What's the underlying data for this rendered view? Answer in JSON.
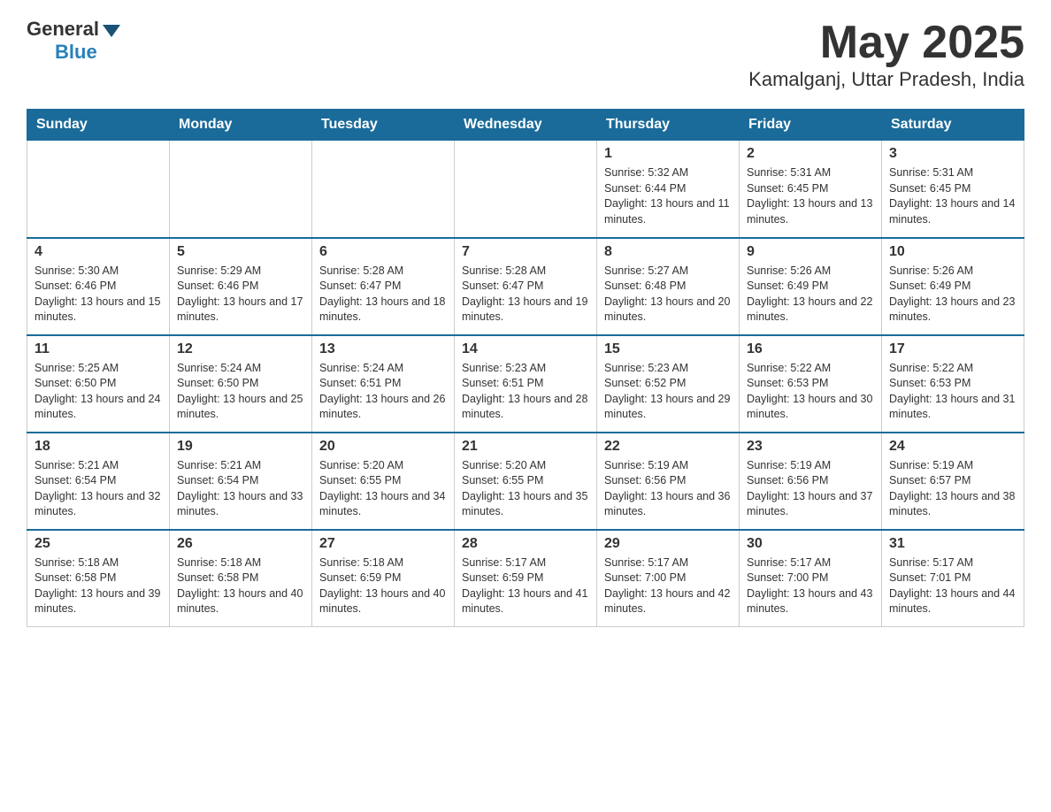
{
  "header": {
    "logo_general": "General",
    "logo_blue": "Blue",
    "title": "May 2025",
    "subtitle": "Kamalganj, Uttar Pradesh, India"
  },
  "calendar": {
    "days_of_week": [
      "Sunday",
      "Monday",
      "Tuesday",
      "Wednesday",
      "Thursday",
      "Friday",
      "Saturday"
    ],
    "weeks": [
      [
        {
          "day": "",
          "info": ""
        },
        {
          "day": "",
          "info": ""
        },
        {
          "day": "",
          "info": ""
        },
        {
          "day": "",
          "info": ""
        },
        {
          "day": "1",
          "info": "Sunrise: 5:32 AM\nSunset: 6:44 PM\nDaylight: 13 hours and 11 minutes."
        },
        {
          "day": "2",
          "info": "Sunrise: 5:31 AM\nSunset: 6:45 PM\nDaylight: 13 hours and 13 minutes."
        },
        {
          "day": "3",
          "info": "Sunrise: 5:31 AM\nSunset: 6:45 PM\nDaylight: 13 hours and 14 minutes."
        }
      ],
      [
        {
          "day": "4",
          "info": "Sunrise: 5:30 AM\nSunset: 6:46 PM\nDaylight: 13 hours and 15 minutes."
        },
        {
          "day": "5",
          "info": "Sunrise: 5:29 AM\nSunset: 6:46 PM\nDaylight: 13 hours and 17 minutes."
        },
        {
          "day": "6",
          "info": "Sunrise: 5:28 AM\nSunset: 6:47 PM\nDaylight: 13 hours and 18 minutes."
        },
        {
          "day": "7",
          "info": "Sunrise: 5:28 AM\nSunset: 6:47 PM\nDaylight: 13 hours and 19 minutes."
        },
        {
          "day": "8",
          "info": "Sunrise: 5:27 AM\nSunset: 6:48 PM\nDaylight: 13 hours and 20 minutes."
        },
        {
          "day": "9",
          "info": "Sunrise: 5:26 AM\nSunset: 6:49 PM\nDaylight: 13 hours and 22 minutes."
        },
        {
          "day": "10",
          "info": "Sunrise: 5:26 AM\nSunset: 6:49 PM\nDaylight: 13 hours and 23 minutes."
        }
      ],
      [
        {
          "day": "11",
          "info": "Sunrise: 5:25 AM\nSunset: 6:50 PM\nDaylight: 13 hours and 24 minutes."
        },
        {
          "day": "12",
          "info": "Sunrise: 5:24 AM\nSunset: 6:50 PM\nDaylight: 13 hours and 25 minutes."
        },
        {
          "day": "13",
          "info": "Sunrise: 5:24 AM\nSunset: 6:51 PM\nDaylight: 13 hours and 26 minutes."
        },
        {
          "day": "14",
          "info": "Sunrise: 5:23 AM\nSunset: 6:51 PM\nDaylight: 13 hours and 28 minutes."
        },
        {
          "day": "15",
          "info": "Sunrise: 5:23 AM\nSunset: 6:52 PM\nDaylight: 13 hours and 29 minutes."
        },
        {
          "day": "16",
          "info": "Sunrise: 5:22 AM\nSunset: 6:53 PM\nDaylight: 13 hours and 30 minutes."
        },
        {
          "day": "17",
          "info": "Sunrise: 5:22 AM\nSunset: 6:53 PM\nDaylight: 13 hours and 31 minutes."
        }
      ],
      [
        {
          "day": "18",
          "info": "Sunrise: 5:21 AM\nSunset: 6:54 PM\nDaylight: 13 hours and 32 minutes."
        },
        {
          "day": "19",
          "info": "Sunrise: 5:21 AM\nSunset: 6:54 PM\nDaylight: 13 hours and 33 minutes."
        },
        {
          "day": "20",
          "info": "Sunrise: 5:20 AM\nSunset: 6:55 PM\nDaylight: 13 hours and 34 minutes."
        },
        {
          "day": "21",
          "info": "Sunrise: 5:20 AM\nSunset: 6:55 PM\nDaylight: 13 hours and 35 minutes."
        },
        {
          "day": "22",
          "info": "Sunrise: 5:19 AM\nSunset: 6:56 PM\nDaylight: 13 hours and 36 minutes."
        },
        {
          "day": "23",
          "info": "Sunrise: 5:19 AM\nSunset: 6:56 PM\nDaylight: 13 hours and 37 minutes."
        },
        {
          "day": "24",
          "info": "Sunrise: 5:19 AM\nSunset: 6:57 PM\nDaylight: 13 hours and 38 minutes."
        }
      ],
      [
        {
          "day": "25",
          "info": "Sunrise: 5:18 AM\nSunset: 6:58 PM\nDaylight: 13 hours and 39 minutes."
        },
        {
          "day": "26",
          "info": "Sunrise: 5:18 AM\nSunset: 6:58 PM\nDaylight: 13 hours and 40 minutes."
        },
        {
          "day": "27",
          "info": "Sunrise: 5:18 AM\nSunset: 6:59 PM\nDaylight: 13 hours and 40 minutes."
        },
        {
          "day": "28",
          "info": "Sunrise: 5:17 AM\nSunset: 6:59 PM\nDaylight: 13 hours and 41 minutes."
        },
        {
          "day": "29",
          "info": "Sunrise: 5:17 AM\nSunset: 7:00 PM\nDaylight: 13 hours and 42 minutes."
        },
        {
          "day": "30",
          "info": "Sunrise: 5:17 AM\nSunset: 7:00 PM\nDaylight: 13 hours and 43 minutes."
        },
        {
          "day": "31",
          "info": "Sunrise: 5:17 AM\nSunset: 7:01 PM\nDaylight: 13 hours and 44 minutes."
        }
      ]
    ]
  }
}
